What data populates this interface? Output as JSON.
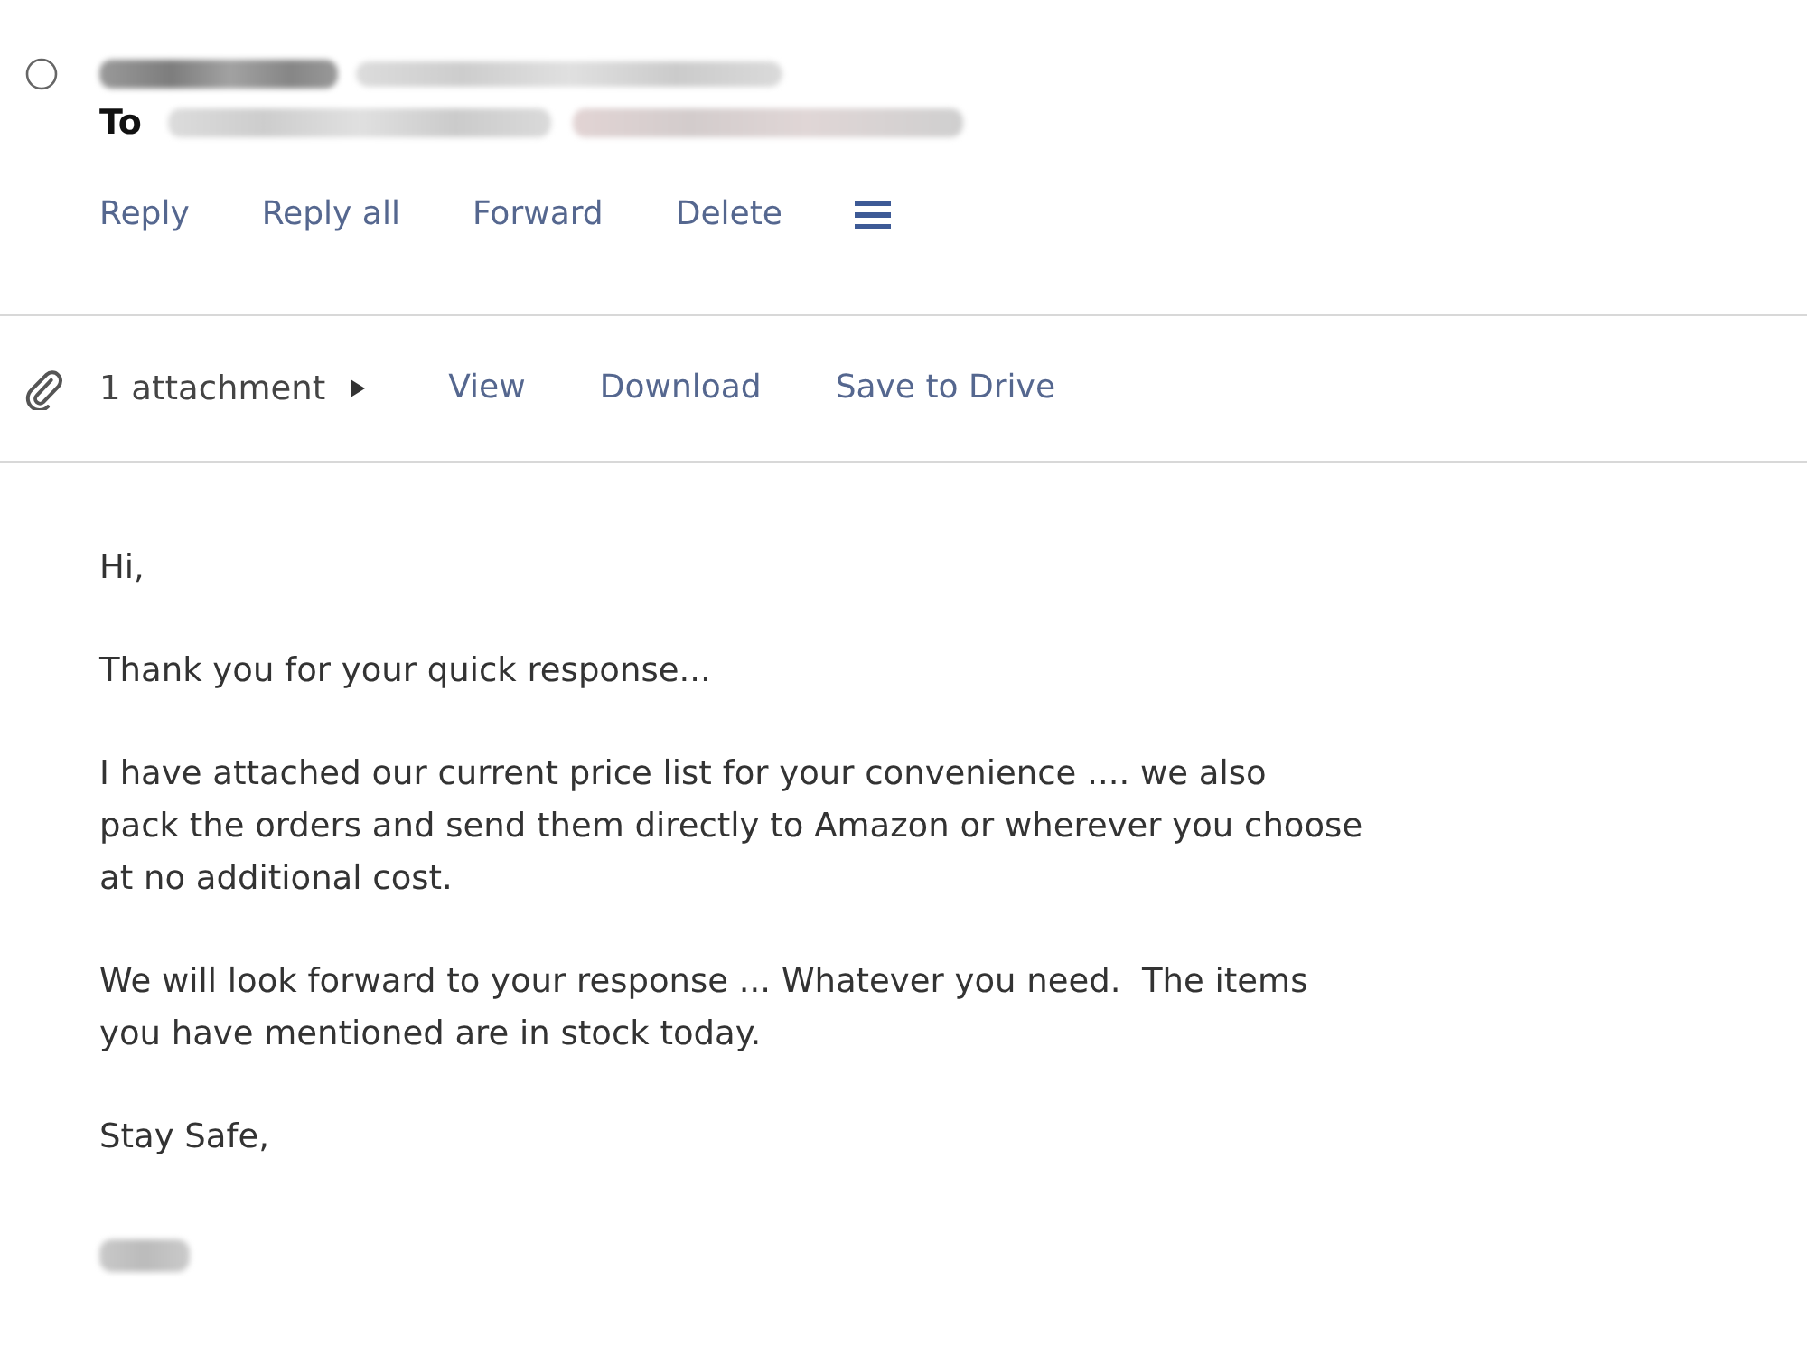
{
  "message": {
    "selected": false
  },
  "recipients": {
    "label": "To"
  },
  "actions": [
    {
      "label": "Reply"
    },
    {
      "label": "Reply all"
    },
    {
      "label": "Forward"
    },
    {
      "label": "Delete"
    }
  ],
  "attachments": {
    "summary": "1 attachment",
    "expanded": false,
    "actions": [
      {
        "label": "View"
      },
      {
        "label": "Download"
      },
      {
        "label": "Save to Drive"
      }
    ]
  },
  "body": {
    "paragraphs": [
      {
        "lines": [
          "Hi,"
        ]
      },
      {
        "lines": [
          "Thank you for your quick response..."
        ]
      },
      {
        "lines": [
          "I have attached our current price list for your convenience .... we also",
          "pack the orders and send them directly to Amazon or wherever you choose",
          "at no additional cost."
        ]
      },
      {
        "lines": [
          "We will look forward to your response ... Whatever you need.  The items",
          "you have mentioned are in stock today."
        ]
      },
      {
        "lines": [
          "Stay Safe,"
        ]
      }
    ]
  }
}
